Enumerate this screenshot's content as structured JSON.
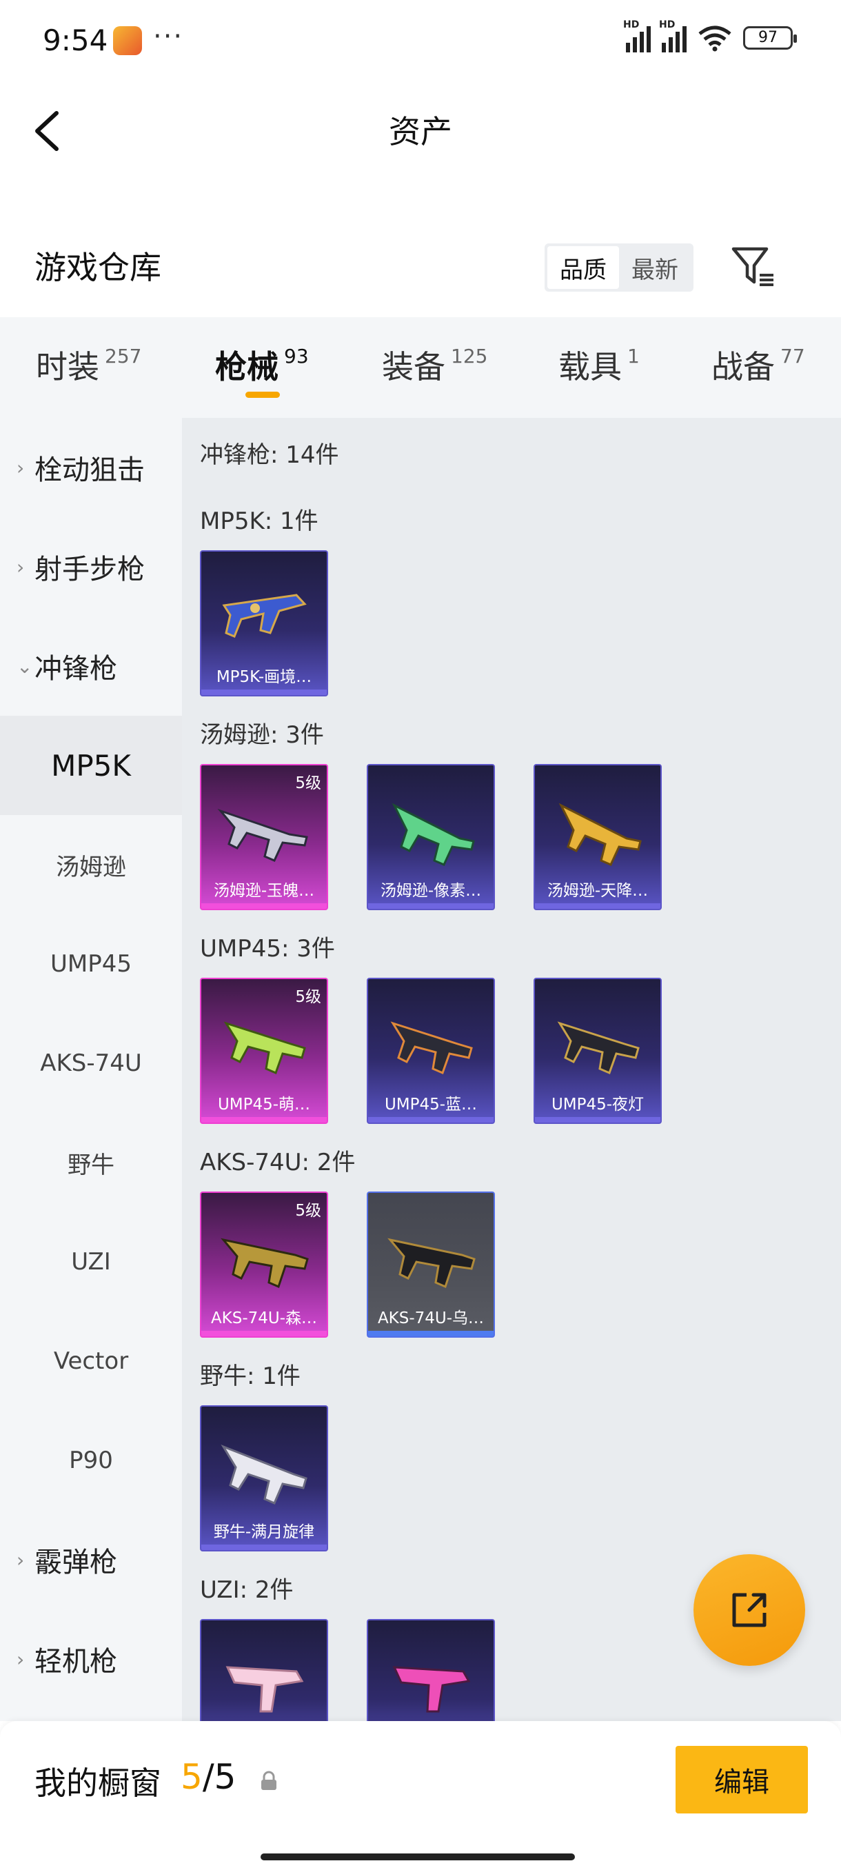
{
  "status_bar": {
    "time": "9:54",
    "more": "···",
    "battery": "97",
    "hd1": "HD",
    "hd2": "HD"
  },
  "header": {
    "title": "资产"
  },
  "warehouse": {
    "title": "游戏仓库",
    "sort_options": [
      "品质",
      "最新"
    ],
    "sort_active": "品质"
  },
  "tabs": [
    {
      "label": "时装",
      "count": "257"
    },
    {
      "label": "枪械",
      "count": "93"
    },
    {
      "label": "装备",
      "count": "125"
    },
    {
      "label": "载具",
      "count": "1"
    },
    {
      "label": "战备",
      "count": "77"
    }
  ],
  "active_tab": "枪械",
  "sidebar": {
    "groups": [
      {
        "label": "栓动狙击",
        "chevron": "›"
      },
      {
        "label": "射手步枪",
        "chevron": "›"
      },
      {
        "label": "冲锋枪",
        "chevron": "⌄"
      },
      {
        "label": "霰弹枪",
        "chevron": "›"
      },
      {
        "label": "轻机枪",
        "chevron": "›"
      }
    ],
    "subitems": [
      "MP5K",
      "汤姆逊",
      "UMP45",
      "AKS-74U",
      "野牛",
      "UZI",
      "Vector",
      "P90"
    ],
    "active_sub": "MP5K"
  },
  "content": {
    "category_title": "冲锋枪: 14件",
    "groups": [
      {
        "title": "MP5K: 1件",
        "items": [
          {
            "name": "MP5K-画境…",
            "level": "",
            "rarity": "purple"
          }
        ]
      },
      {
        "title": "汤姆逊: 3件",
        "items": [
          {
            "name": "汤姆逊-玉魄…",
            "level": "5级",
            "rarity": "pink"
          },
          {
            "name": "汤姆逊-像素…",
            "level": "",
            "rarity": "purple"
          },
          {
            "name": "汤姆逊-天降…",
            "level": "",
            "rarity": "purple"
          }
        ]
      },
      {
        "title": "UMP45: 3件",
        "items": [
          {
            "name": "UMP45-萌…",
            "level": "5级",
            "rarity": "pink"
          },
          {
            "name": "UMP45-蓝…",
            "level": "",
            "rarity": "purple"
          },
          {
            "name": "UMP45-夜灯",
            "level": "",
            "rarity": "purple"
          }
        ]
      },
      {
        "title": "AKS-74U: 2件",
        "items": [
          {
            "name": "AKS-74U-森…",
            "level": "5级",
            "rarity": "pink"
          },
          {
            "name": "AKS-74U-乌…",
            "level": "",
            "rarity": "gray"
          }
        ]
      },
      {
        "title": "野牛: 1件",
        "items": [
          {
            "name": "野牛-满月旋律",
            "level": "",
            "rarity": "purple"
          }
        ]
      },
      {
        "title": "UZI: 2件",
        "items": [
          {
            "name": "",
            "level": "",
            "rarity": "purple"
          },
          {
            "name": "",
            "level": "",
            "rarity": "purple"
          }
        ]
      }
    ]
  },
  "bottom": {
    "showcase_label": "我的橱窗",
    "showcase_current": "5",
    "showcase_total": "/5",
    "edit_label": "编辑"
  },
  "colors": {
    "accent": "#f7a600",
    "edit_button": "#fbb714",
    "pink_rarity": "#ee3fd1",
    "purple_rarity": "#5c55c8",
    "gray_rarity": "#5470e8"
  },
  "icons": {
    "back": "back-arrow-icon",
    "filter": "filter-icon",
    "export": "share-export-icon",
    "lock": "lock-icon"
  }
}
